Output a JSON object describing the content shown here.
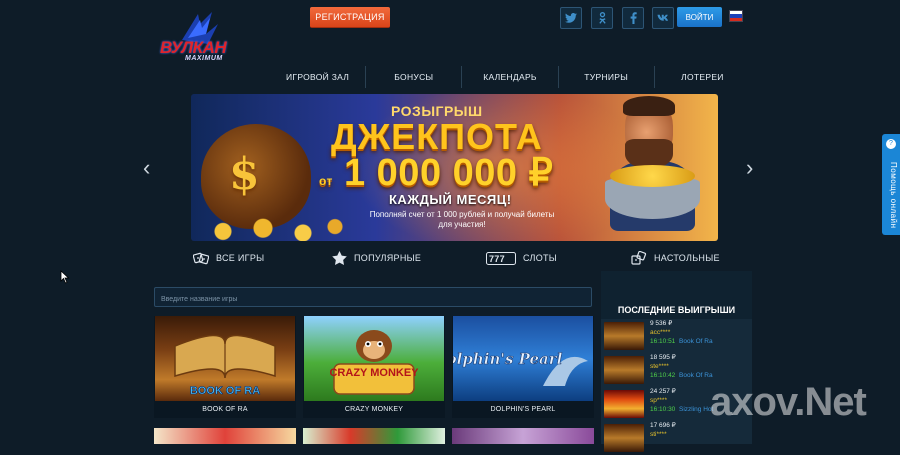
{
  "header": {
    "logo_text": "ВУЛКАН",
    "logo_sub": "MAXIMUM",
    "register_label": "РЕГИСТРАЦИЯ",
    "login_label": "ВОЙТИ",
    "socials": [
      "twitter-icon",
      "odnoklassniki-icon",
      "facebook-icon",
      "vk-icon"
    ],
    "flag_colors": [
      "#ffffff",
      "#1c3fb8",
      "#d52b1e"
    ]
  },
  "nav": {
    "items": [
      "ИГРОВОЙ ЗАЛ",
      "БОНУСЫ",
      "КАЛЕНДАРЬ",
      "ТУРНИРЫ",
      "ЛОТЕРЕИ"
    ]
  },
  "banner": {
    "line1": "РОЗЫГРЫШ",
    "line2": "ДЖЕКПОТА",
    "line3_prefix": "от",
    "line3_amount": "1 000 000 ₽",
    "line4": "КАЖДЫЙ МЕСЯЦ!",
    "line5": "Пополняй счет от 1 000 рублей и получай билеты для участия!"
  },
  "categories": [
    {
      "label": "ВСЕ ИГРЫ",
      "icon": "dice-icon"
    },
    {
      "label": "ПОПУЛЯРНЫЕ",
      "icon": "star-icon"
    },
    {
      "label": "СЛОТЫ",
      "icon": "slot-777-icon"
    },
    {
      "label": "НАСТОЛЬНЫЕ",
      "icon": "table-dice-icon"
    }
  ],
  "search": {
    "placeholder": "Введите название игры"
  },
  "games": [
    {
      "title": "BOOK OF RA",
      "art": "BOOK OF RA"
    },
    {
      "title": "CRAZY MONKEY",
      "art": "CRAZY MONKEY"
    },
    {
      "title": "DOLPHIN'S PEARL",
      "art": "Dolphin's Pearl"
    }
  ],
  "winners": {
    "title": "ПОСЛЕДНИЕ ВЫИГРЫШИ",
    "rows": [
      {
        "amount": "9 536 ₽",
        "user": "acc****",
        "time": "16:10:51",
        "game": "Book Of Ra"
      },
      {
        "amount": "18 595 ₽",
        "user": "ste****",
        "time": "16:10:42",
        "game": "Book Of Ra"
      },
      {
        "amount": "24 257 ₽",
        "user": "sp****",
        "time": "16:10:30",
        "game": "Sizzling Hot"
      },
      {
        "amount": "17 696 ₽",
        "user": "sti****",
        "time": "",
        "game": ""
      }
    ]
  },
  "help_label": "Помощь онлайн",
  "watermark": "axov.Net"
}
